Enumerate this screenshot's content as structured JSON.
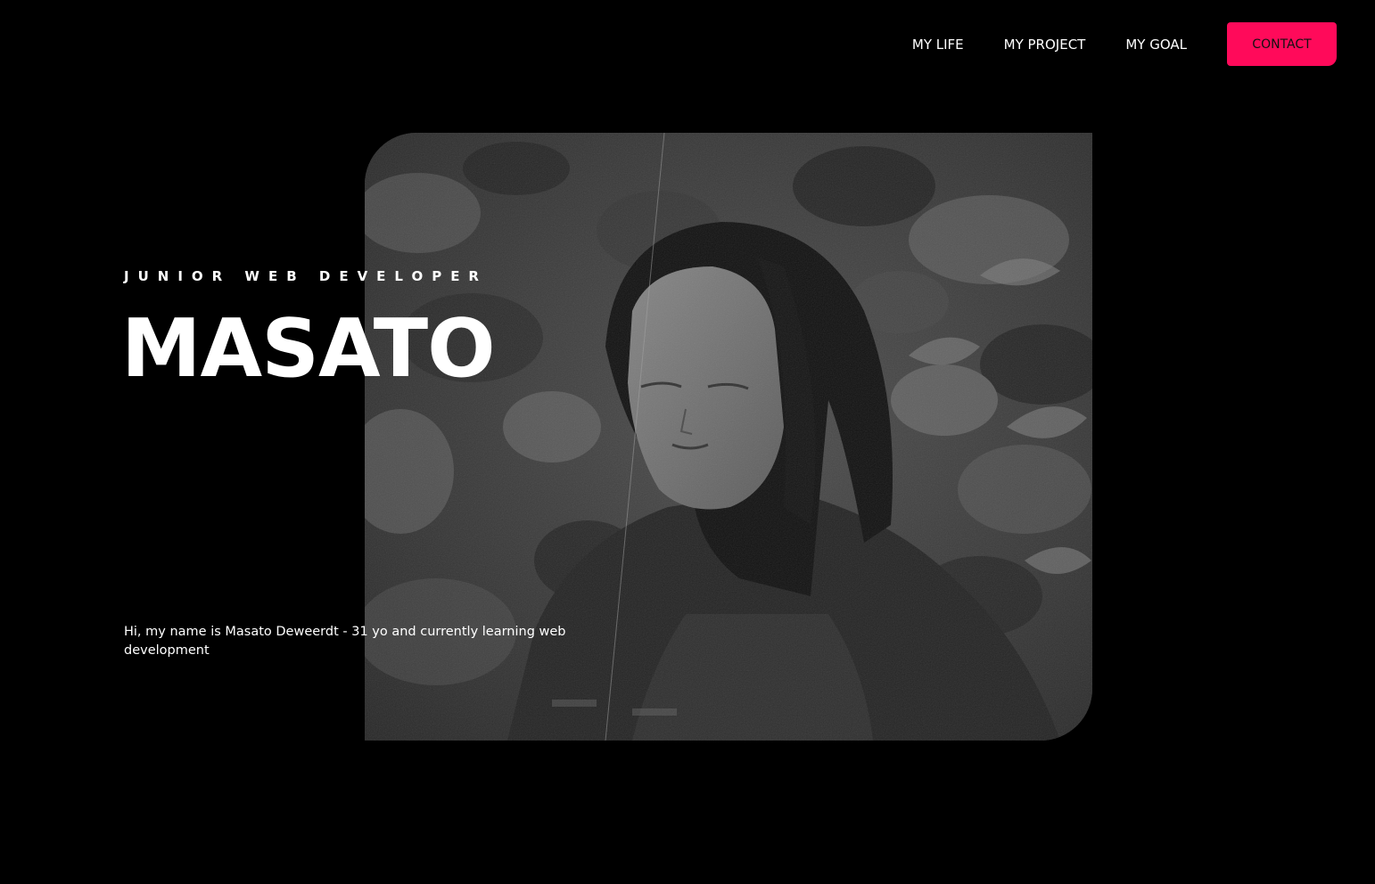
{
  "nav": {
    "links": [
      "MY LIFE",
      "MY PROJECT",
      "MY GOAL"
    ],
    "contact_label": "CONTACT"
  },
  "hero": {
    "subtitle": "JUNIOR WEB DEVELOPER",
    "title": "MASATO",
    "intro": "Hi, my name is Masato Deweerdt - 31 yo and currently learning web development"
  },
  "colors": {
    "background": "#000000",
    "accent": "#ff0a5a",
    "text": "#ffffff"
  }
}
